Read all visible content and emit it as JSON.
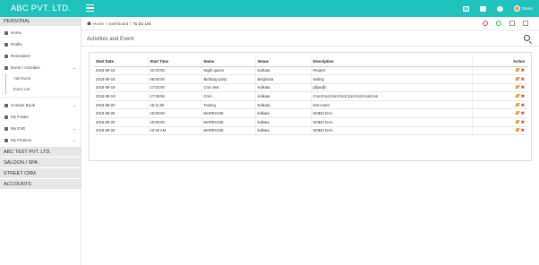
{
  "header": {
    "brand": "ABC PVT. LTD.",
    "user_name": "Demo"
  },
  "sidebar": {
    "section_title": "PERSONAL",
    "items": [
      {
        "label": "Home",
        "icon": "home-icon"
      },
      {
        "label": "Profile",
        "icon": "user-icon"
      },
      {
        "label": "Reminders",
        "icon": "bell-icon"
      },
      {
        "label": "Event / Activities",
        "icon": "calendar-icon",
        "expandable": true
      }
    ],
    "sub_items": [
      "Add Event",
      "Event List"
    ],
    "items_2": [
      {
        "label": "Contact Book",
        "icon": "address-book-icon",
        "expandable": true
      },
      {
        "label": "My Folder",
        "icon": "folder-icon"
      },
      {
        "label": "My EVE",
        "icon": "money-icon",
        "expandable": true
      },
      {
        "label": "My Finance",
        "icon": "rupee-icon",
        "expandable": true
      }
    ],
    "companies": [
      "ABC TEST PVT. LTD.",
      "SALOON / SPA",
      "STREET CRM",
      "ACCOUNTS"
    ]
  },
  "breadcrumb": {
    "home": "Home",
    "sep1": "/",
    "dashboard": "Dashboard",
    "sep2": "/",
    "current": "To Do List"
  },
  "panel": {
    "title": "Activities and Event"
  },
  "table": {
    "headers": [
      "Start Date",
      "Start Time",
      "Name",
      "Venue",
      "Description",
      "Action"
    ],
    "rows": [
      [
        "2018-09-15",
        "22:00:00",
        "Night queen",
        "Kolkata",
        "Peoject"
      ],
      [
        "2018-09-18",
        "06:00:00",
        "Birthday party",
        "Belgharia",
        "testing"
      ],
      [
        "2018-09-19",
        "17:02:00",
        "Cron test",
        "Kolkata",
        "jdlyauljh"
      ],
      [
        "2018-09-19",
        "17:09:00",
        "Cron",
        "Kolkata",
        "CronCronCronCronCronCronCronCron"
      ],
      [
        "2018-09-20",
        "15:11:00",
        "Testing",
        "Kolkata",
        "test event"
      ],
      [
        "2018-09-25",
        "10:00:00",
        "MARRIAGE",
        "kolkata",
        "NOBO DAA"
      ],
      [
        "2018-09-25",
        "10:00:00",
        "MARRIAGE",
        "kolkata",
        "NOBO DAA"
      ],
      [
        "2018-09-25",
        "10:30 AM",
        "MARRIAGE",
        "kolkata",
        "NOBO DAA"
      ]
    ]
  },
  "colors": {
    "accent": "#1fc2bd",
    "edit": "#e8a33d",
    "delete": "#e04545"
  }
}
